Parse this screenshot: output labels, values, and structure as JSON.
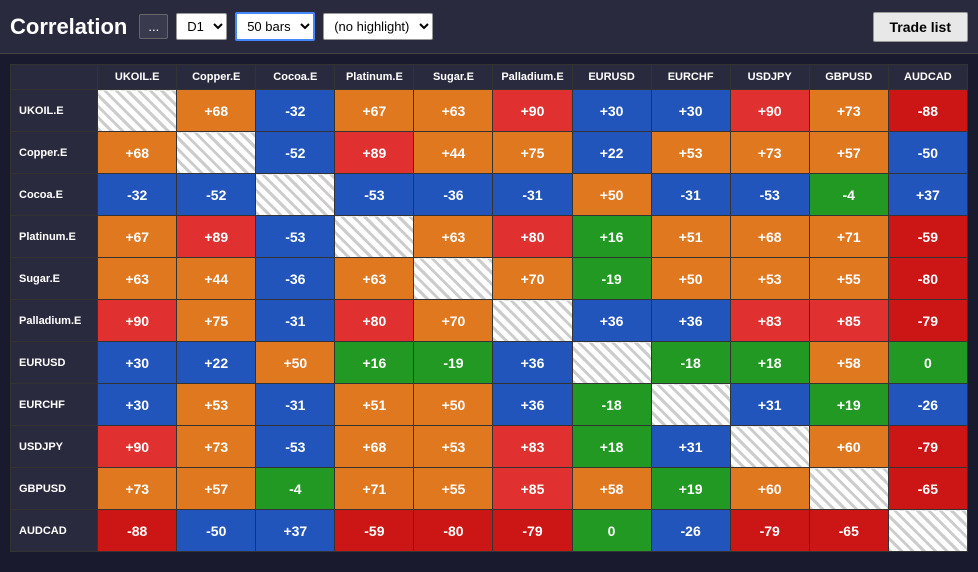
{
  "header": {
    "title": "Correlation",
    "more_btn": "...",
    "timeframe": "D1",
    "bars": "50 bars",
    "highlight": "(no highlight)",
    "trade_list": "Trade list"
  },
  "columns": [
    "UKOIL.E",
    "Copper.E",
    "Cocoa.E",
    "Platinum.E",
    "Sugar.E",
    "Palladium.E",
    "EURUSD",
    "EURCHF",
    "USDJPY",
    "GBPUSD",
    "AUDCAD"
  ],
  "rows": [
    {
      "label": "UKOIL.E",
      "cells": [
        {
          "v": null,
          "diag": true
        },
        {
          "v": "+68",
          "color": "orange"
        },
        {
          "v": "-32",
          "color": "blue"
        },
        {
          "v": "+67",
          "color": "orange"
        },
        {
          "v": "+63",
          "color": "orange"
        },
        {
          "v": "+90",
          "color": "red"
        },
        {
          "v": "+30",
          "color": "blue"
        },
        {
          "v": "+30",
          "color": "blue"
        },
        {
          "v": "+90",
          "color": "red"
        },
        {
          "v": "+73",
          "color": "orange"
        },
        {
          "v": "-88",
          "color": "darkred"
        }
      ]
    },
    {
      "label": "Copper.E",
      "cells": [
        {
          "v": "+68",
          "color": "orange"
        },
        {
          "v": null,
          "diag": true
        },
        {
          "v": "-52",
          "color": "blue"
        },
        {
          "v": "+89",
          "color": "red"
        },
        {
          "v": "+44",
          "color": "orange"
        },
        {
          "v": "+75",
          "color": "orange"
        },
        {
          "v": "+22",
          "color": "blue"
        },
        {
          "v": "+53",
          "color": "orange"
        },
        {
          "v": "+73",
          "color": "orange"
        },
        {
          "v": "+57",
          "color": "orange"
        },
        {
          "v": "-50",
          "color": "blue"
        }
      ]
    },
    {
      "label": "Cocoa.E",
      "cells": [
        {
          "v": "-32",
          "color": "blue"
        },
        {
          "v": "-52",
          "color": "blue"
        },
        {
          "v": null,
          "diag": true
        },
        {
          "v": "-53",
          "color": "blue"
        },
        {
          "v": "-36",
          "color": "blue"
        },
        {
          "v": "-31",
          "color": "blue"
        },
        {
          "v": "+50",
          "color": "orange"
        },
        {
          "v": "-31",
          "color": "blue"
        },
        {
          "v": "-53",
          "color": "blue"
        },
        {
          "v": "-4",
          "color": "green"
        },
        {
          "v": "+37",
          "color": "blue"
        }
      ]
    },
    {
      "label": "Platinum.E",
      "cells": [
        {
          "v": "+67",
          "color": "orange"
        },
        {
          "v": "+89",
          "color": "red"
        },
        {
          "v": "-53",
          "color": "blue"
        },
        {
          "v": null,
          "diag": true
        },
        {
          "v": "+63",
          "color": "orange"
        },
        {
          "v": "+80",
          "color": "red"
        },
        {
          "v": "+16",
          "color": "green"
        },
        {
          "v": "+51",
          "color": "orange"
        },
        {
          "v": "+68",
          "color": "orange"
        },
        {
          "v": "+71",
          "color": "orange"
        },
        {
          "v": "-59",
          "color": "darkred"
        }
      ]
    },
    {
      "label": "Sugar.E",
      "cells": [
        {
          "v": "+63",
          "color": "orange"
        },
        {
          "v": "+44",
          "color": "orange"
        },
        {
          "v": "-36",
          "color": "blue"
        },
        {
          "v": "+63",
          "color": "orange"
        },
        {
          "v": null,
          "diag": true
        },
        {
          "v": "+70",
          "color": "orange"
        },
        {
          "v": "-19",
          "color": "green"
        },
        {
          "v": "+50",
          "color": "orange"
        },
        {
          "v": "+53",
          "color": "orange"
        },
        {
          "v": "+55",
          "color": "orange"
        },
        {
          "v": "-80",
          "color": "darkred"
        }
      ]
    },
    {
      "label": "Palladium.E",
      "cells": [
        {
          "v": "+90",
          "color": "red"
        },
        {
          "v": "+75",
          "color": "orange"
        },
        {
          "v": "-31",
          "color": "blue"
        },
        {
          "v": "+80",
          "color": "red"
        },
        {
          "v": "+70",
          "color": "orange"
        },
        {
          "v": null,
          "diag": true
        },
        {
          "v": "+36",
          "color": "blue"
        },
        {
          "v": "+36",
          "color": "blue"
        },
        {
          "v": "+83",
          "color": "red"
        },
        {
          "v": "+85",
          "color": "red"
        },
        {
          "v": "-79",
          "color": "darkred"
        }
      ]
    },
    {
      "label": "EURUSD",
      "cells": [
        {
          "v": "+30",
          "color": "blue"
        },
        {
          "v": "+22",
          "color": "blue"
        },
        {
          "v": "+50",
          "color": "orange"
        },
        {
          "v": "+16",
          "color": "green"
        },
        {
          "v": "-19",
          "color": "green"
        },
        {
          "v": "+36",
          "color": "blue"
        },
        {
          "v": null,
          "diag": true
        },
        {
          "v": "-18",
          "color": "green"
        },
        {
          "v": "+18",
          "color": "green"
        },
        {
          "v": "+58",
          "color": "orange"
        },
        {
          "v": "0",
          "color": "green"
        }
      ]
    },
    {
      "label": "EURCHF",
      "cells": [
        {
          "v": "+30",
          "color": "blue"
        },
        {
          "v": "+53",
          "color": "orange"
        },
        {
          "v": "-31",
          "color": "blue"
        },
        {
          "v": "+51",
          "color": "orange"
        },
        {
          "v": "+50",
          "color": "orange"
        },
        {
          "v": "+36",
          "color": "blue"
        },
        {
          "v": "-18",
          "color": "green"
        },
        {
          "v": null,
          "diag": true
        },
        {
          "v": "+31",
          "color": "blue"
        },
        {
          "v": "+19",
          "color": "green"
        },
        {
          "v": "-26",
          "color": "blue"
        }
      ]
    },
    {
      "label": "USDJPY",
      "cells": [
        {
          "v": "+90",
          "color": "red"
        },
        {
          "v": "+73",
          "color": "orange"
        },
        {
          "v": "-53",
          "color": "blue"
        },
        {
          "v": "+68",
          "color": "orange"
        },
        {
          "v": "+53",
          "color": "orange"
        },
        {
          "v": "+83",
          "color": "red"
        },
        {
          "v": "+18",
          "color": "green"
        },
        {
          "v": "+31",
          "color": "blue"
        },
        {
          "v": null,
          "diag": true
        },
        {
          "v": "+60",
          "color": "orange"
        },
        {
          "v": "-79",
          "color": "darkred"
        }
      ]
    },
    {
      "label": "GBPUSD",
      "cells": [
        {
          "v": "+73",
          "color": "orange"
        },
        {
          "v": "+57",
          "color": "orange"
        },
        {
          "v": "-4",
          "color": "green"
        },
        {
          "v": "+71",
          "color": "orange"
        },
        {
          "v": "+55",
          "color": "orange"
        },
        {
          "v": "+85",
          "color": "red"
        },
        {
          "v": "+58",
          "color": "orange"
        },
        {
          "v": "+19",
          "color": "green"
        },
        {
          "v": "+60",
          "color": "orange"
        },
        {
          "v": null,
          "diag": true
        },
        {
          "v": "-65",
          "color": "darkred"
        }
      ]
    },
    {
      "label": "AUDCAD",
      "cells": [
        {
          "v": "-88",
          "color": "darkred"
        },
        {
          "v": "-50",
          "color": "blue"
        },
        {
          "v": "+37",
          "color": "blue"
        },
        {
          "v": "-59",
          "color": "darkred"
        },
        {
          "v": "-80",
          "color": "darkred"
        },
        {
          "v": "-79",
          "color": "darkred"
        },
        {
          "v": "0",
          "color": "green"
        },
        {
          "v": "-26",
          "color": "blue"
        },
        {
          "v": "-79",
          "color": "darkred"
        },
        {
          "v": "-65",
          "color": "darkred"
        },
        {
          "v": null,
          "diag": true
        }
      ]
    }
  ]
}
